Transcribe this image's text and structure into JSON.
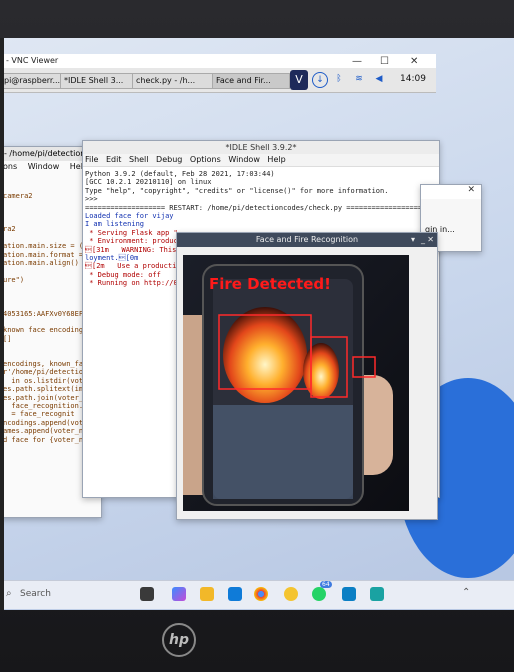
{
  "vnc": {
    "title": "- VNC Viewer",
    "minimize": "—",
    "maximize": "☐",
    "close": "✕"
  },
  "taskbar_top": {
    "tabs": [
      "pi@raspberr...",
      "*IDLE Shell 3...",
      "check.py - /h...",
      "Face and Fir..."
    ],
    "clock": "14:09"
  },
  "left_editor": {
    "path": "- /home/pi/detection",
    "menu": [
      "ons",
      "Window",
      "Help"
    ],
    "lines": [
      "",
      "",
      "camera2",
      "",
      "",
      "",
      "ra2",
      "",
      "ation.main.size = (480",
      "ation.main.format = \"R",
      "ation.main.align()  #",
      "",
      "ure\")",
      "",
      "",
      "",
      "4053165:AAFXv0Y68EFq4p",
      "",
      "known face encodings",
      "[]",
      "",
      "",
      "encodings, known_face_",
      "r'/home/pi/detectionco",
      "  in os.listdir(voter_",
      "es.path.splitext(image",
      "es.path.join(voter_ima",
      "  face_recognition.load",
      "  = face_recognit",
      "ncodings.append(voter_f",
      "ames.append(voter_name)",
      "d face for {voter_name"
    ]
  },
  "idle": {
    "title": "*IDLE Shell 3.9.2*",
    "menu": [
      "File",
      "Edit",
      "Shell",
      "Debug",
      "Options",
      "Window",
      "Help"
    ],
    "lines": [
      "Python 3.9.2 (default, Feb 28 2021, 17:03:44)",
      "[GCC 10.2.1 20210110] on linux",
      "Type \"help\", \"copyright\", \"credits\" or \"license()\" for more information.",
      ">>>",
      "=================== RESTART: /home/pi/detectioncodes/check.py ===================",
      "Loaded face for vijay",
      "I am listening",
      " * Serving Flask app \"",
      " * Environment: produc",
      "\u001b[31m   WARNING: This",
      "loyment.\u001b[0m",
      "\u001b[2m   Use a production",
      " * Debug mode: off",
      " * Running on http://0"
    ]
  },
  "right_window": {
    "label": "gin in..."
  },
  "face_fire": {
    "title": "Face and Fire Recognition",
    "alert": "Fire Detected!"
  },
  "search": {
    "placeholder": "Search"
  },
  "badge": "64",
  "brand": "hp"
}
